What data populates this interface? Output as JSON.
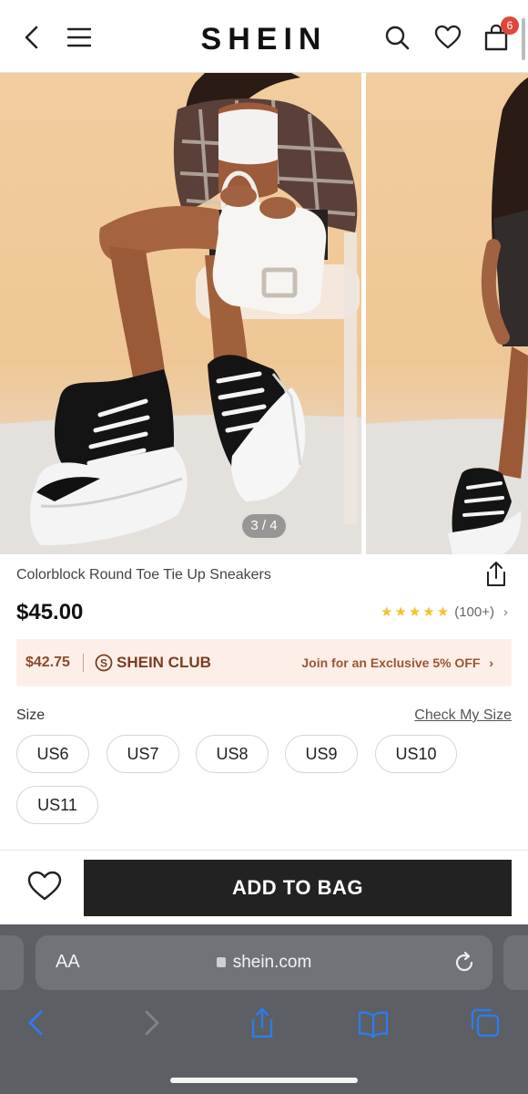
{
  "header": {
    "logo": "SHEIN",
    "cart_count": "6",
    "icons": [
      "back-icon",
      "menu-icon",
      "search-icon",
      "heart-icon",
      "bag-icon"
    ]
  },
  "gallery": {
    "counter": "3 / 4"
  },
  "product": {
    "title": "Colorblock Round Toe Tie Up Sneakers",
    "price": "$45.00",
    "rating_stars": 4.5,
    "review_count": "(100+)"
  },
  "club": {
    "price": "$42.75",
    "name": "SHEIN CLUB",
    "offer": "Join for an Exclusive 5% OFF"
  },
  "size": {
    "label": "Size",
    "check_link": "Check My Size",
    "options": [
      "US6",
      "US7",
      "US8",
      "US9",
      "US10",
      "US11"
    ]
  },
  "action": {
    "add_to_bag": "ADD TO BAG"
  },
  "browser": {
    "text_size": "AA",
    "domain": "shein.com"
  },
  "colors": {
    "accent_black": "#222222",
    "club_bg": "#fdefe8",
    "club_text": "#9b5631",
    "badge_red": "#e0463e",
    "star_yellow": "#f6c12c",
    "safari_bar": "#5c5f63",
    "safari_blue": "#2f7bea"
  }
}
